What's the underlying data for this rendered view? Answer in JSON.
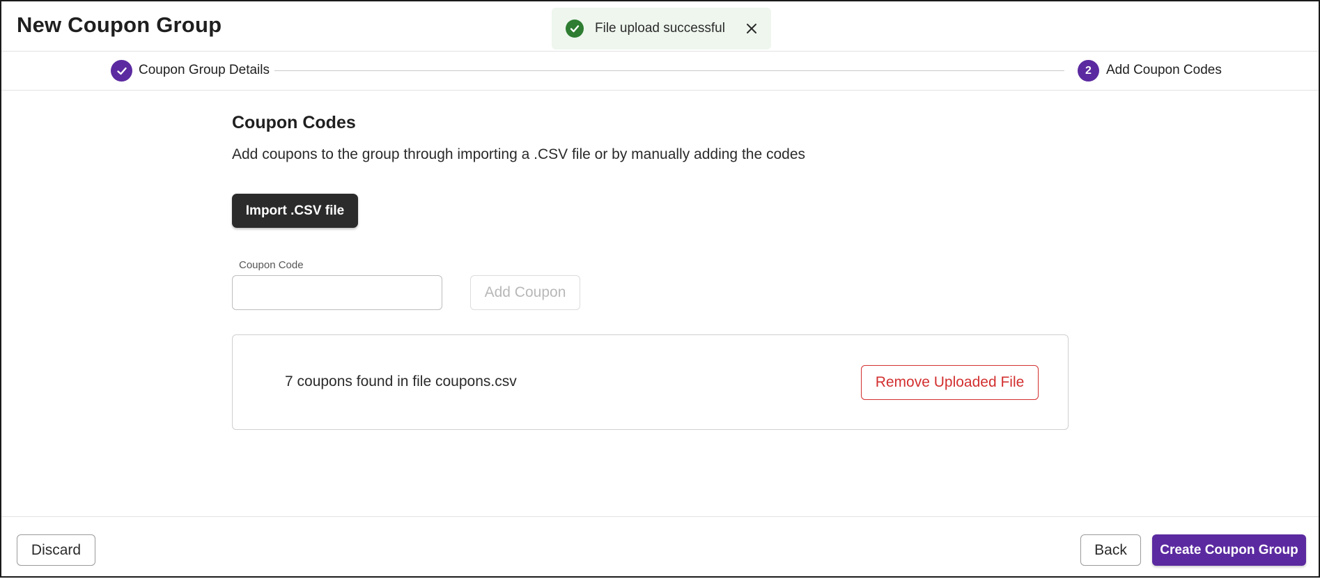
{
  "header": {
    "title": "New Coupon Group"
  },
  "toast": {
    "message": "File upload successful",
    "icon": "check-circle-icon",
    "close_icon": "close-icon",
    "color": "#2e7d32"
  },
  "stepper": {
    "steps": [
      {
        "label": "Coupon Group Details",
        "state": "completed",
        "marker": "check-icon"
      },
      {
        "label": "Add Coupon Codes",
        "state": "active",
        "marker": "2"
      }
    ],
    "accent": "#5b2aa0"
  },
  "main": {
    "title": "Coupon Codes",
    "description": "Add coupons to the group through importing a .CSV file or by manually adding the codes",
    "import_button": "Import .CSV file",
    "coupon_field": {
      "label": "Coupon Code",
      "value": "",
      "placeholder": ""
    },
    "add_button": "Add Coupon",
    "file_summary": "7 coupons found in file coupons.csv",
    "remove_button": "Remove Uploaded File"
  },
  "footer": {
    "discard": "Discard",
    "back": "Back",
    "create": "Create Coupon Group"
  }
}
